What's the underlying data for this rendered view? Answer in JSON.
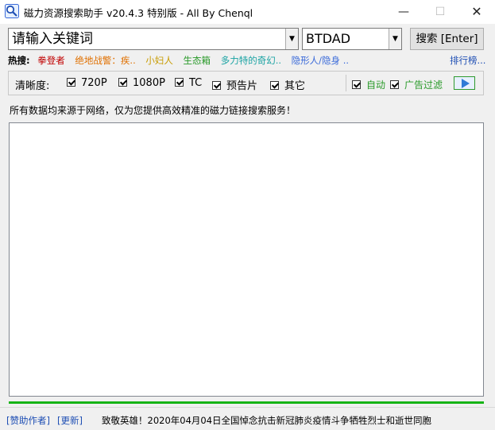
{
  "window": {
    "title": "磁力资源搜索助手 v20.4.3 特别版 - All By Chenql",
    "min_glyph": "—",
    "max_glyph": "☐",
    "close_glyph": "✕"
  },
  "search": {
    "placeholder": "请输入关键词",
    "value": "",
    "engine": "BTDAD",
    "button_label": "搜索 [Enter]"
  },
  "hot": {
    "label": "热搜:",
    "items": [
      {
        "text": "拳登者",
        "color": "#c00000"
      },
      {
        "text": "绝地战警：疾..",
        "color": "#e07000"
      },
      {
        "text": "小妇人",
        "color": "#c89b00"
      },
      {
        "text": "生态箱",
        "color": "#2a9a2a"
      },
      {
        "text": "多力特的奇幻..",
        "color": "#1aa3a3"
      },
      {
        "text": "隐形人/隐身 ..",
        "color": "#3a6ad9"
      }
    ],
    "rank_link": "排行榜..."
  },
  "filters": {
    "label": "清晰度:",
    "options": [
      {
        "label": "720P",
        "checked": true
      },
      {
        "label": "1080P",
        "checked": true
      },
      {
        "label": "TC",
        "checked": true
      },
      {
        "label": "预告片",
        "checked": true
      },
      {
        "label": "其它",
        "checked": true
      }
    ],
    "auto": {
      "label": "自动",
      "checked": true,
      "color": "#2a9a2a"
    },
    "ad_filter": {
      "label": "广告过滤",
      "checked": true,
      "color": "#2a9a2a"
    }
  },
  "notice": "所有数据均来源于网络，仅为您提供高效精准的磁力链接搜索服务！",
  "progress_fraction": 1.0,
  "status": {
    "donate_link": "[赞助作者]",
    "update_link": "[更新]",
    "message": "致敬英雄！2020年04月04日全国悼念抗击新冠肺炎疫情斗争牺牲烈士和逝世同胞"
  },
  "colors": {
    "accent_link": "#1f4fb4",
    "progress": "#16b416"
  }
}
